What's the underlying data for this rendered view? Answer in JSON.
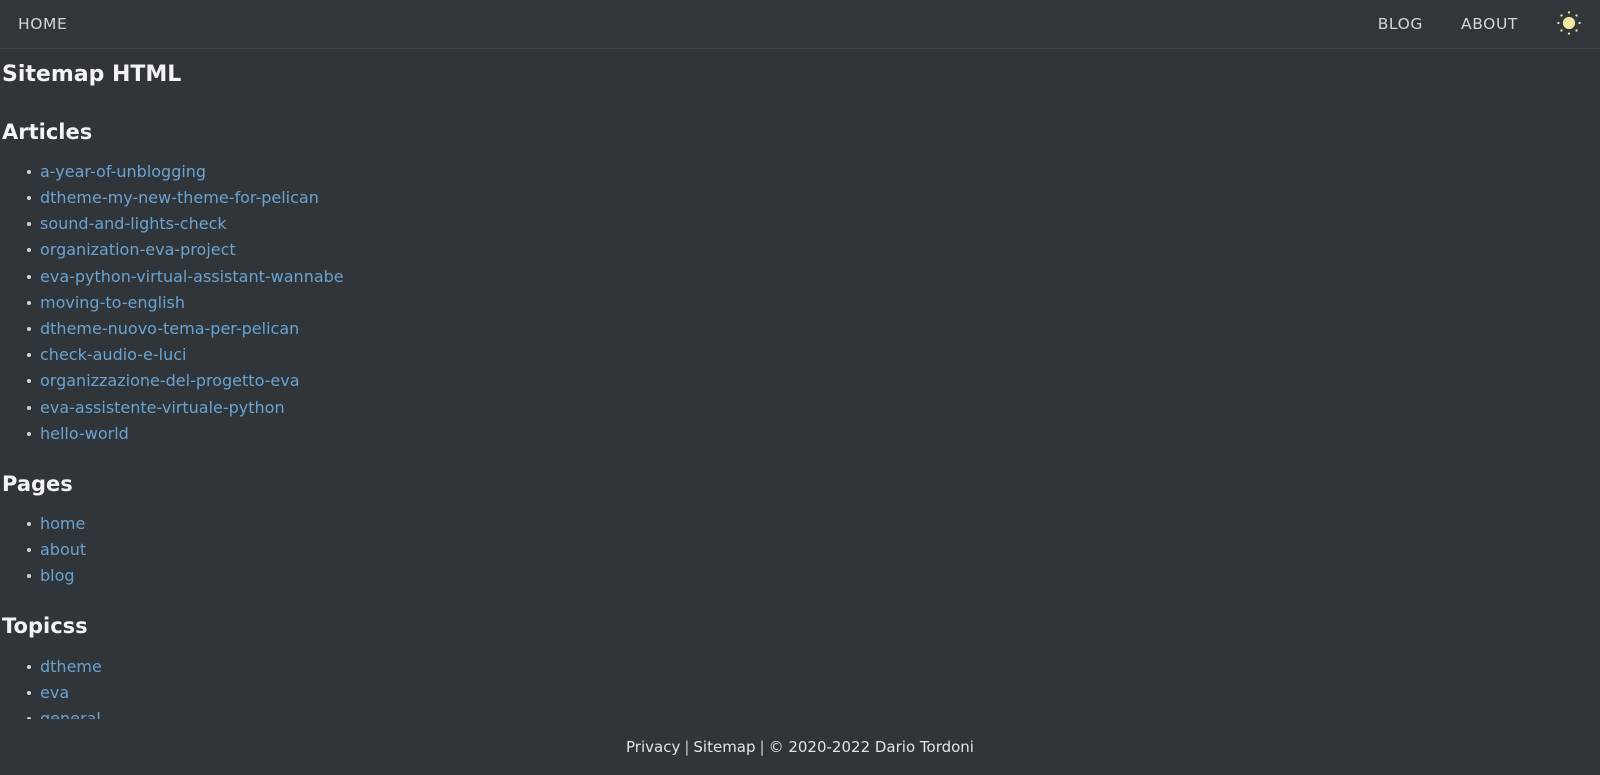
{
  "header": {
    "nav_left": [
      {
        "label": "HOME",
        "name": "nav-link-home"
      }
    ],
    "nav_right": [
      {
        "label": "BLOG",
        "name": "nav-link-blog"
      },
      {
        "label": "ABOUT",
        "name": "nav-link-about"
      }
    ],
    "theme_toggle_icon": "sun-icon",
    "theme_toggle_color": "#f2e9a0"
  },
  "main": {
    "page_title": "Sitemap HTML",
    "sections": [
      {
        "heading": "Articles",
        "items": [
          "a-year-of-unblogging",
          "dtheme-my-new-theme-for-pelican",
          "sound-and-lights-check",
          "organization-eva-project",
          "eva-python-virtual-assistant-wannabe",
          "moving-to-english",
          "dtheme-nuovo-tema-per-pelican",
          "check-audio-e-luci",
          "organizzazione-del-progetto-eva",
          "eva-assistente-virtuale-python",
          "hello-world"
        ]
      },
      {
        "heading": "Pages",
        "items": [
          "home",
          "about",
          "blog"
        ]
      },
      {
        "heading": "Topicss",
        "items": [
          "dtheme",
          "eva",
          "general"
        ]
      }
    ]
  },
  "footer": {
    "privacy_label": "Privacy",
    "sitemap_label": "Sitemap",
    "separator": "|",
    "copyright": "© 2020-2022 Dario Tordoni"
  },
  "colors": {
    "background": "#30353a",
    "header_background": "#31363b",
    "link": "#6ba3d0",
    "text": "#e8e8e8",
    "heading": "#f2f3f4",
    "accent_sun": "#f2e9a0"
  }
}
